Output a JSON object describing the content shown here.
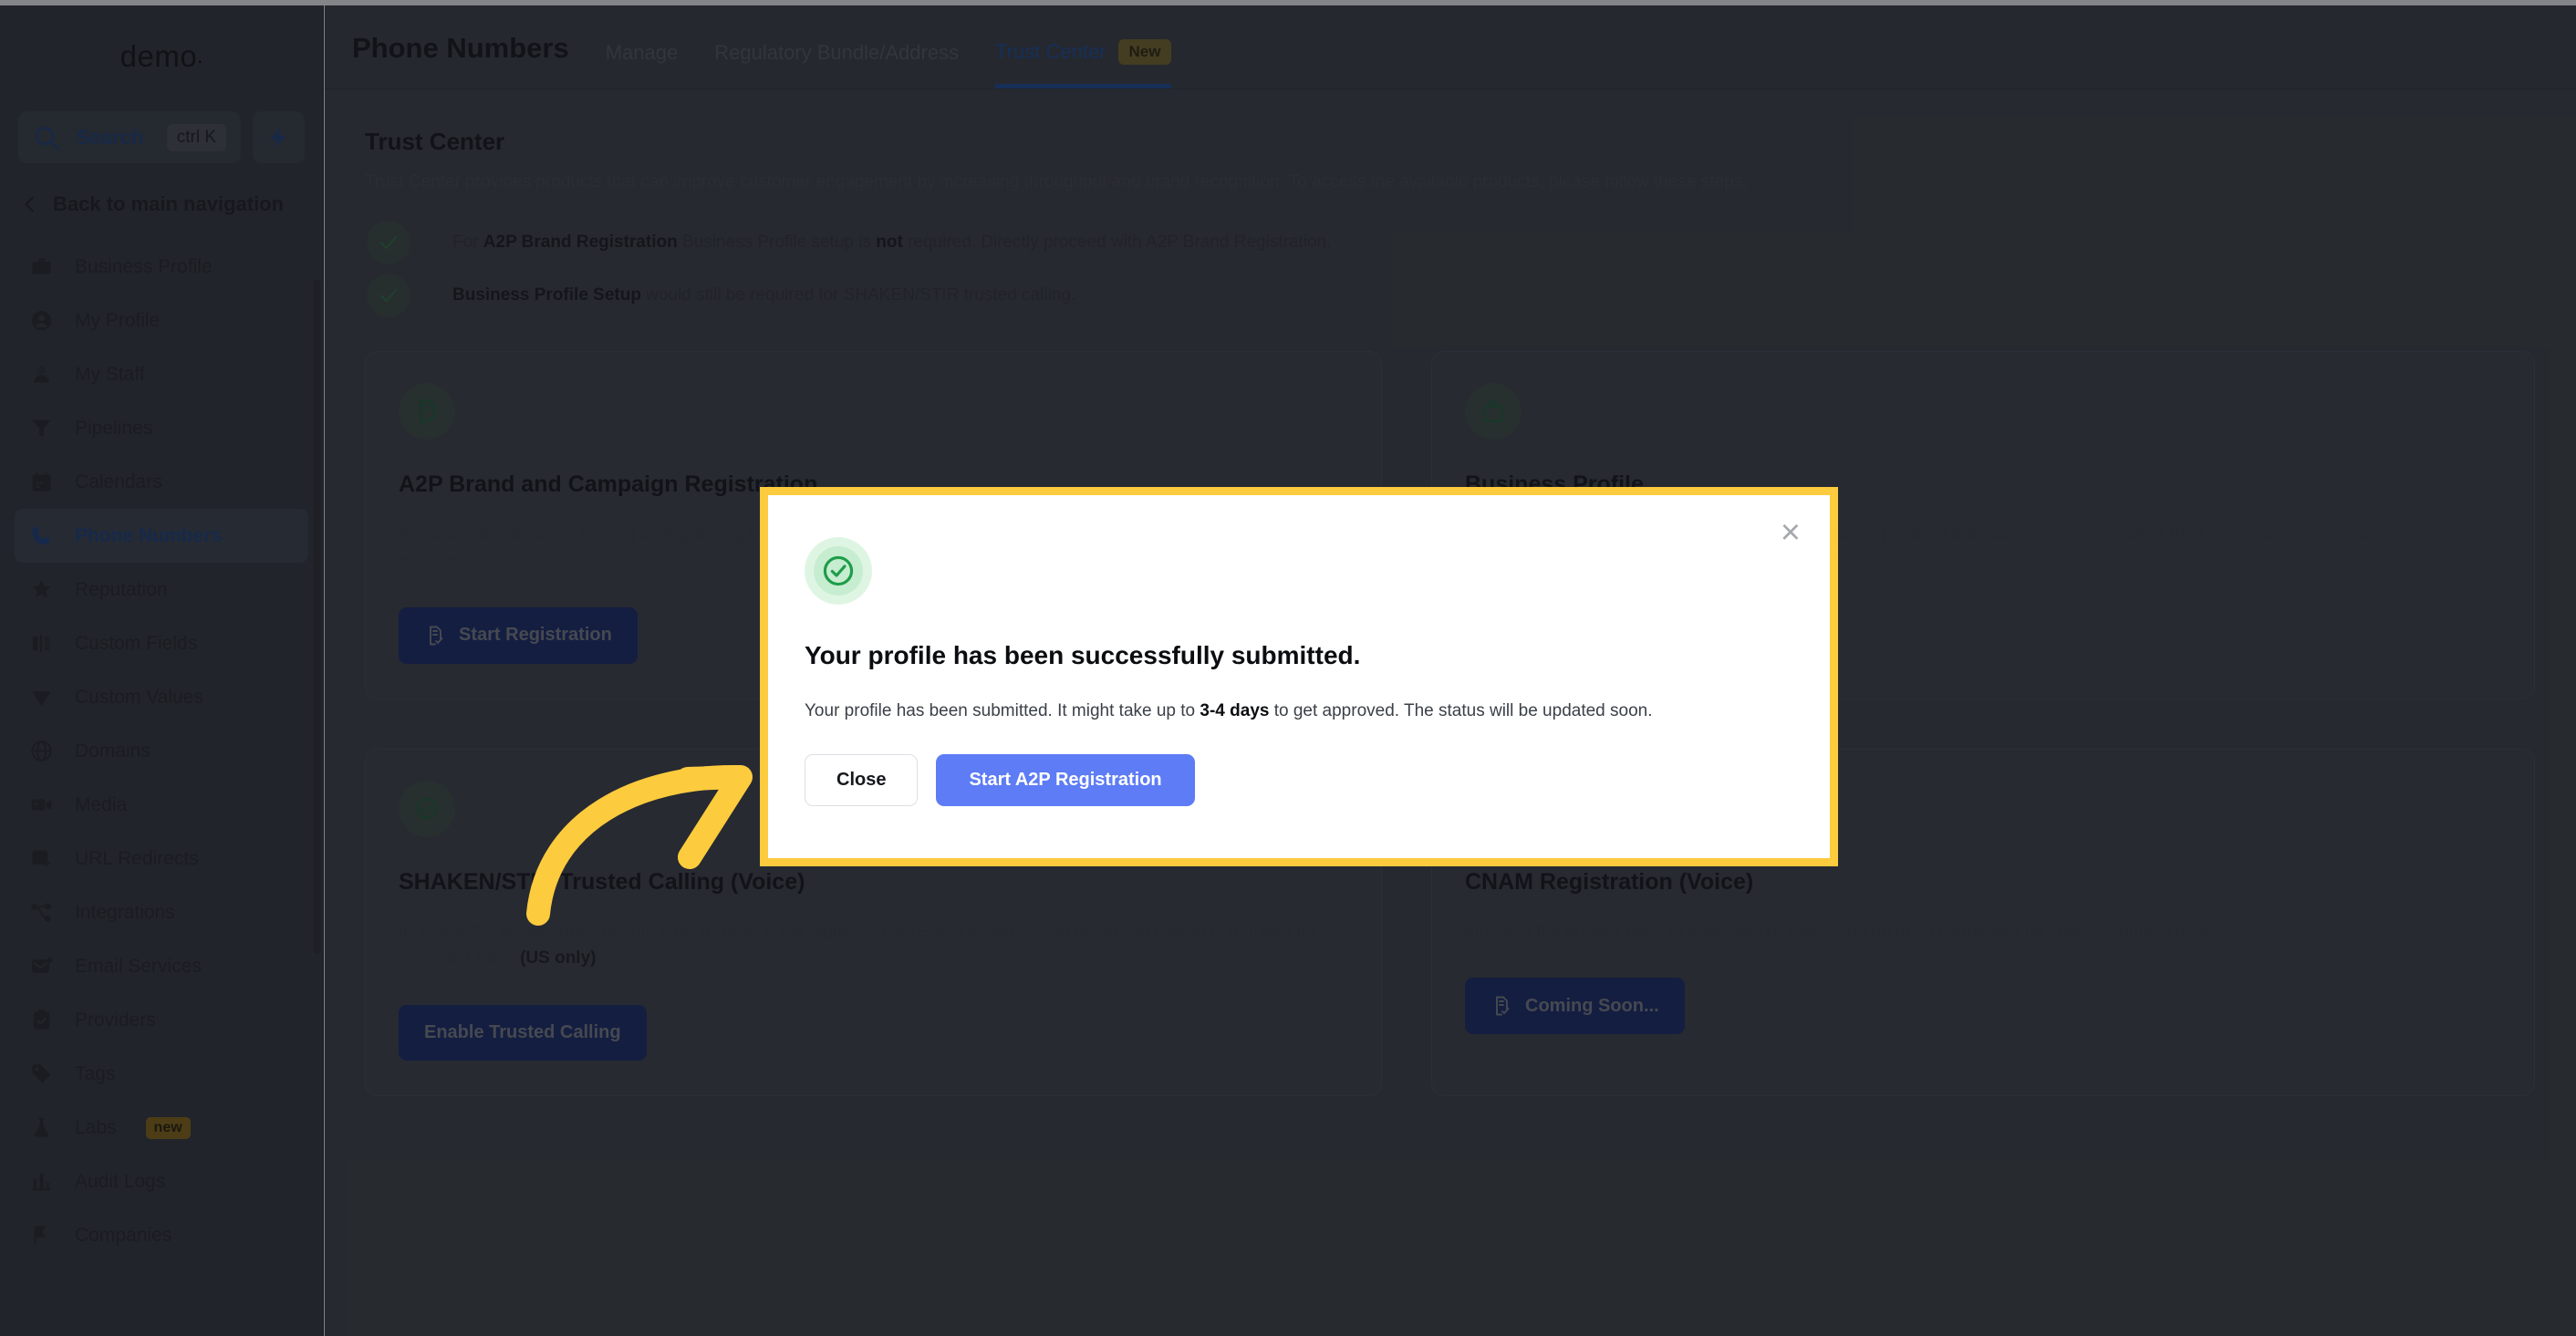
{
  "sidebar": {
    "brand": "demo",
    "search": {
      "label": "Search",
      "shortcut": "ctrl K",
      "icon": "search-icon"
    },
    "bolt_icon": "lightning-bolt-icon",
    "back_label": "Back to main navigation",
    "items": [
      {
        "label": "Business Profile",
        "icon": "briefcase-icon",
        "active": false
      },
      {
        "label": "My Profile",
        "icon": "user-circle-icon",
        "active": false
      },
      {
        "label": "My Staff",
        "icon": "user-icon",
        "active": false
      },
      {
        "label": "Pipelines",
        "icon": "funnel-icon",
        "active": false
      },
      {
        "label": "Calendars",
        "icon": "calendar-icon",
        "active": false
      },
      {
        "label": "Phone Numbers",
        "icon": "phone-icon",
        "active": true
      },
      {
        "label": "Reputation",
        "icon": "star-icon",
        "active": false
      },
      {
        "label": "Custom Fields",
        "icon": "columns-icon",
        "active": false
      },
      {
        "label": "Custom Values",
        "icon": "diamond-icon",
        "active": false
      },
      {
        "label": "Domains",
        "icon": "globe-icon",
        "active": false
      },
      {
        "label": "Media",
        "icon": "video-camera-icon",
        "active": false
      },
      {
        "label": "URL Redirects",
        "icon": "cursor-window-icon",
        "active": false
      },
      {
        "label": "Integrations",
        "icon": "share-nodes-icon",
        "active": false
      },
      {
        "label": "Email Services",
        "icon": "envelope-dot-icon",
        "active": false
      },
      {
        "label": "Providers",
        "icon": "clipboard-check-icon",
        "active": false
      },
      {
        "label": "Tags",
        "icon": "tag-icon",
        "active": false
      },
      {
        "label": "Labs",
        "icon": "flask-icon",
        "active": false,
        "badge": "new"
      },
      {
        "label": "Audit Logs",
        "icon": "bar-chart-icon",
        "active": false
      },
      {
        "label": "Companies",
        "icon": "flag-icon",
        "active": false
      }
    ]
  },
  "topbar": {
    "title": "Phone Numbers",
    "tabs": [
      {
        "label": "Manage",
        "active": false
      },
      {
        "label": "Regulatory Bundle/Address",
        "active": false
      },
      {
        "label": "Trust Center",
        "active": true,
        "badge": "New"
      }
    ]
  },
  "main": {
    "section_title": "Trust Center",
    "section_desc": "Trust Center provides products that can improve customer engagement by increasing throughput and brand recognition. To access the available products, please follow these steps.",
    "steps": [
      {
        "icon": "check-icon",
        "prefix": "For ",
        "bold1": "A2P Brand Registration",
        "mid": " Business Profile setup is ",
        "bold2": "not",
        "suffix": " required. Directly proceed with A2P Brand Registration."
      },
      {
        "icon": "check-icon",
        "prefix": "",
        "bold1": "Business Profile Setup",
        "mid": " would still be required for SHAKEN/STIR trusted calling.",
        "bold2": "",
        "suffix": ""
      }
    ],
    "cards": [
      {
        "icon": "document-check-icon",
        "title": "A2P Brand and Campaign Registration",
        "desc_prefix": "Avoid additional carrier filtering by registering your brand. Required for all SMS/MMS sent to the ",
        "desc_bold": "US(only)",
        "desc_suffix": " via 10DLC numbers.",
        "button": "Start Registration",
        "button_icon": "document-check-icon"
      },
      {
        "icon": "briefcase-icon",
        "title": "Business Profile",
        "desc_prefix": "Completing your Business Profile gives you access to products that can increase consumer trust. To create a Business Profile, you'll need information about your business.",
        "desc_bold": "",
        "desc_suffix": "",
        "button": "",
        "button_icon": ""
      },
      {
        "icon": "badge-check-icon",
        "title": "SHAKEN/STIR Trusted Calling (Voice)",
        "desc_prefix": "Increase the answer rates of your calls by getting the highest SHAKEN/STIR attestation rating. No coding is required for outbound calls. ",
        "desc_bold": "(US only)",
        "desc_suffix": "",
        "button": "Enable Trusted Calling",
        "button_icon": ""
      },
      {
        "icon": "user-check-icon",
        "title": "CNAM Registration (Voice)",
        "desc_prefix": "Increase the answer rates of your calls by displaying up to 15 characters on your customer's phone.",
        "desc_bold": "",
        "desc_suffix": "",
        "button": "Coming Soon...",
        "button_icon": "document-check-icon"
      }
    ]
  },
  "modal": {
    "icon": "success-check-circle-icon",
    "close_label": "×",
    "title": "Your profile has been successfully submitted.",
    "body_prefix": "Your profile has been submitted. It might take up to ",
    "body_bold": "3-4 days",
    "body_suffix": " to get approved. The status will be updated soon.",
    "close_button": "Close",
    "primary_button": "Start A2P Registration"
  },
  "annotation": {
    "arrow": "curved-arrow-pointing-right",
    "arrow_color": "#FDCB3E",
    "highlight_color": "#FDCB3E"
  }
}
